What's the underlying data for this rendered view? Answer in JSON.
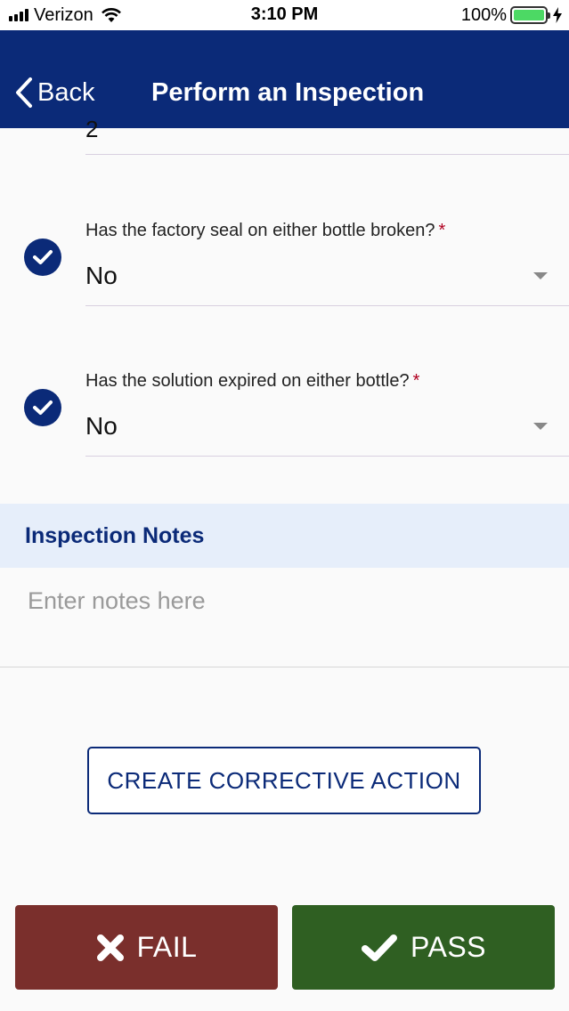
{
  "status_bar": {
    "carrier": "Verizon",
    "time": "3:10 PM",
    "battery": "100%",
    "battery_level": 1.0,
    "icons": [
      "signal-bars-icon",
      "wifi-icon",
      "battery-icon",
      "charging-bolt-icon"
    ]
  },
  "nav": {
    "back_label": "Back",
    "title": "Perform an Inspection"
  },
  "form": {
    "partial_answer": "2",
    "questions": [
      {
        "label": "Has the factory seal on either bottle broken?",
        "required_mark": "*",
        "value": "No"
      },
      {
        "label": "Has the solution expired on either bottle?",
        "required_mark": "*",
        "value": "No"
      }
    ]
  },
  "notes": {
    "title": "Inspection Notes",
    "placeholder": "Enter notes here",
    "value": ""
  },
  "actions": {
    "corrective_label": "CREATE CORRECTIVE ACTION",
    "fail_label": "FAIL",
    "pass_label": "PASS"
  },
  "colors": {
    "brand_navy": "#0b2a78",
    "fail": "#7a2f2c",
    "pass": "#2f5f22",
    "notes_header_bg": "#e6eefa",
    "required": "#b00020"
  }
}
